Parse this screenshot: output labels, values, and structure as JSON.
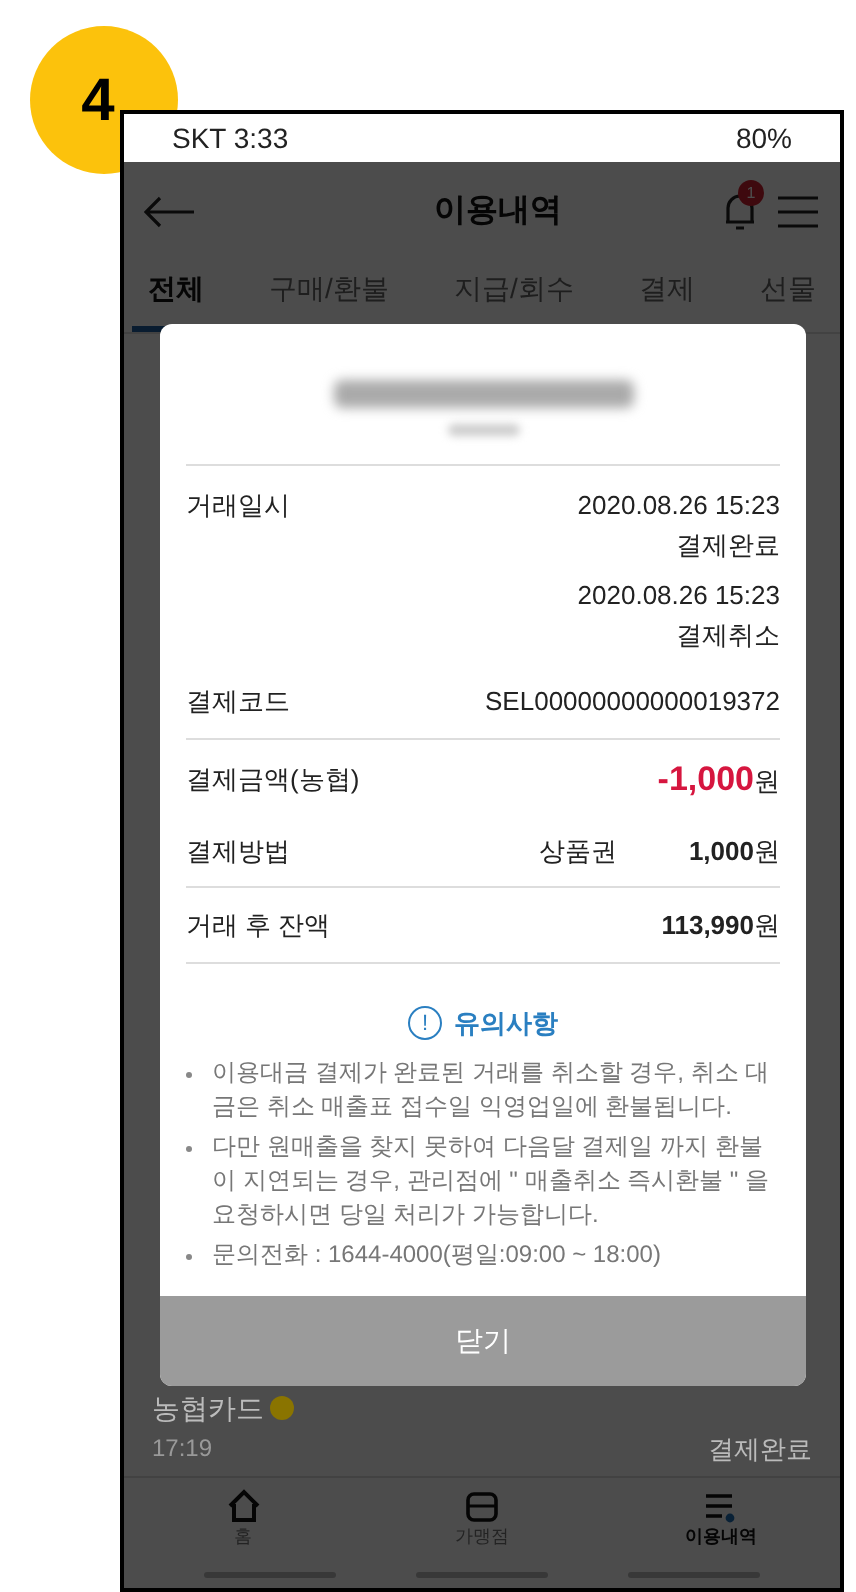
{
  "step_badge": "4",
  "status_bar": {
    "carrier_time": "SKT 3:33",
    "battery": "80%"
  },
  "header": {
    "title": "이용내역",
    "notification_count": "1"
  },
  "tabs": [
    {
      "label": "전체",
      "selected": true
    },
    {
      "label": "구매/환불",
      "selected": false
    },
    {
      "label": "지급/회수",
      "selected": false
    },
    {
      "label": "결제",
      "selected": false
    },
    {
      "label": "선물",
      "selected": false
    }
  ],
  "background_item": {
    "name": "농협카드",
    "time": "17:19",
    "status": "결제완료"
  },
  "bottom_nav": [
    {
      "label": "홈",
      "kind": "home",
      "selected": false
    },
    {
      "label": "가맹점",
      "kind": "store",
      "selected": false
    },
    {
      "label": "이용내역",
      "kind": "list",
      "selected": true
    }
  ],
  "dialog": {
    "rows": [
      {
        "kind": "datetime",
        "label": "거래일시",
        "entries": [
          {
            "date": "2020.08.26 15:23",
            "status": "결제완료"
          },
          {
            "date": "2020.08.26 15:23",
            "status": "결제취소"
          }
        ]
      },
      {
        "kind": "plain",
        "label": "결제코드",
        "value": "SEL00000000000019372"
      },
      {
        "kind": "amount",
        "label": "결제금액(농협)",
        "value": "-1,000",
        "unit": "원"
      },
      {
        "kind": "method",
        "label": "결제방법",
        "method": "상품권",
        "value": "1,000",
        "unit": "원"
      },
      {
        "kind": "total",
        "label": "거래 후 잔액",
        "value": "113,990",
        "unit": "원"
      }
    ],
    "notice_icon": "!",
    "notice_title": "유의사항",
    "notices": [
      "이용대금 결제가 완료된 거래를 취소할 경우, 취소 대금은 취소 매출표 접수일 익영업일에 환불됩니다.",
      "다만 원매출을 찾지 못하여 다음달 결제일 까지 환불이 지연되는 경우, 관리점에 \" 매출취소 즉시환불 \" 을 요청하시면 당일 처리가 가능합니다.",
      "문의전화 : 1644-4000(평일:09:00 ~ 18:00)"
    ],
    "close_button": "닫기"
  }
}
